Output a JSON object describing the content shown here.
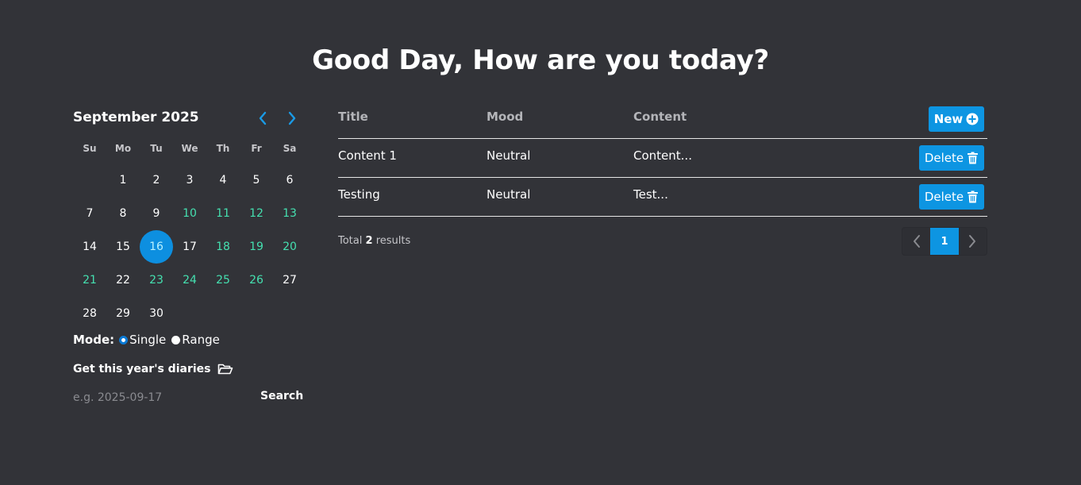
{
  "header": {
    "title": "Good Day, How are you today?"
  },
  "calendar": {
    "month_label": "September 2025",
    "prev_icon": "chevron-left-icon",
    "next_icon": "chevron-right-icon",
    "weekdays": [
      "Su",
      "Mo",
      "Tu",
      "We",
      "Th",
      "Fr",
      "Sa"
    ],
    "first_weekday_index": 1,
    "days_in_month": 30,
    "days": [
      "1",
      "2",
      "3",
      "4",
      "5",
      "6",
      "7",
      "8",
      "9",
      "10",
      "11",
      "12",
      "13",
      "14",
      "15",
      "16",
      "17",
      "18",
      "19",
      "20",
      "21",
      "22",
      "23",
      "24",
      "25",
      "26",
      "27",
      "28",
      "29",
      "30"
    ],
    "selected_day": 16,
    "highlighted_days": [
      10,
      11,
      12,
      13,
      18,
      19,
      20,
      21,
      23,
      24,
      25,
      26
    ],
    "colors": {
      "selected_bg": "#0d8fe0",
      "highlight_text": "#45e0b0"
    }
  },
  "mode": {
    "label": "Mode:",
    "options": [
      {
        "label": "Single",
        "checked": true
      },
      {
        "label": "Range",
        "checked": false
      }
    ]
  },
  "year_diaries": {
    "label": "Get this year's diaries",
    "icon": "folder-open-icon"
  },
  "search": {
    "placeholder": "e.g. 2025-09-17",
    "value": "",
    "button_label": "Search"
  },
  "table": {
    "columns": [
      "Title",
      "Mood",
      "Content"
    ],
    "new_button_label": "New",
    "new_button_icon": "plus-circle-icon",
    "rows": [
      {
        "title": "Content 1",
        "mood": "Neutral",
        "content": "Content...",
        "action_label": "Delete"
      },
      {
        "title": "Testing",
        "mood": "Neutral",
        "content": "Test...",
        "action_label": "Delete"
      }
    ],
    "delete_icon": "trash-icon"
  },
  "footer": {
    "total_prefix": "Total",
    "total_count": "2",
    "total_suffix": "results",
    "pagination": {
      "current_page": "1",
      "prev_icon": "chevron-left-icon",
      "next_icon": "chevron-right-icon"
    }
  },
  "colors": {
    "background": "#323338",
    "accent": "#0d95e2",
    "divider": "#e6e6e6"
  }
}
